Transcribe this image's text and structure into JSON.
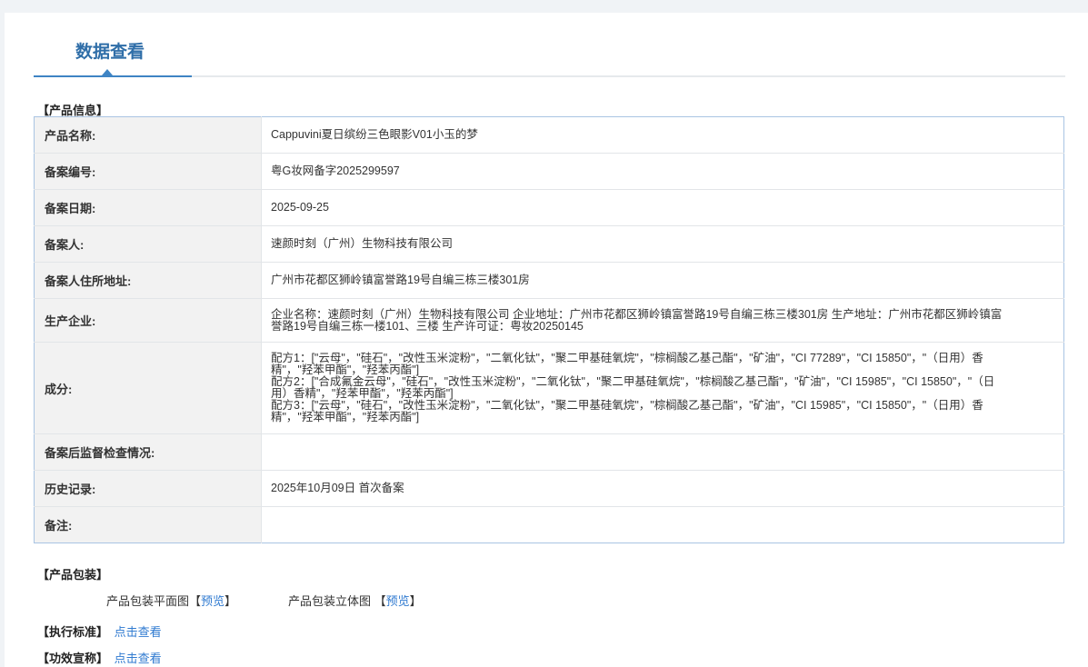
{
  "tab": {
    "title": "数据查看"
  },
  "sections": {
    "product_info": "【产品信息】",
    "packaging": "【产品包装】",
    "standard": "【执行标准】",
    "efficacy": "【功效宣称】"
  },
  "rows": [
    {
      "label": "产品名称:",
      "value": "Cappuvini夏日缤纷三色眼影V01小玉的梦"
    },
    {
      "label": "备案编号:",
      "value": "粤G妆网备字2025299597"
    },
    {
      "label": "备案日期:",
      "value": "2025-09-25"
    },
    {
      "label": "备案人:",
      "value": "速颜时刻（广州）生物科技有限公司"
    },
    {
      "label": "备案人住所地址:",
      "value": "广州市花都区狮岭镇富誉路19号自编三栋三楼301房"
    },
    {
      "label": "生产企业:",
      "value": "企业名称：速颜时刻（广州）生物科技有限公司 企业地址：广州市花都区狮岭镇富誉路19号自编三栋三楼301房 生产地址：广州市花都区狮岭镇富誉路19号自编三栋一楼101、三楼 生产许可证：粤妆20250145"
    },
    {
      "label": "成分:",
      "formulas": [
        "配方1：[\"云母\"，\"硅石\"，\"改性玉米淀粉\"，\"二氧化钛\"，\"聚二甲基硅氧烷\"，\"棕榈酸乙基己酯\"，\"矿油\"，\"CI 77289\"，\"CI 15850\"，\"（日用）香精\"，\"羟苯甲酯\"，\"羟苯丙酯\"]",
        "配方2：[\"合成氟金云母\"，\"硅石\"，\"改性玉米淀粉\"，\"二氧化钛\"，\"聚二甲基硅氧烷\"，\"棕榈酸乙基己酯\"，\"矿油\"，\"CI 15985\"，\"CI 15850\"，\"（日用）香精\"，\"羟苯甲酯\"，\"羟苯丙酯\"]",
        "配方3：[\"云母\"，\"硅石\"，\"改性玉米淀粉\"，\"二氧化钛\"，\"聚二甲基硅氧烷\"，\"棕榈酸乙基己酯\"，\"矿油\"，\"CI 15985\"，\"CI 15850\"，\"（日用）香精\"，\"羟苯甲酯\"，\"羟苯丙酯\"]"
      ]
    },
    {
      "label": "备案后监督检查情况:",
      "value": ""
    },
    {
      "label": "历史记录:",
      "value": "2025年10月09日 首次备案"
    },
    {
      "label": "备注:",
      "value": ""
    }
  ],
  "packaging": {
    "flat_label": "产品包装平面图",
    "flat_link": "预览",
    "stereo_label": "产品包装立体图",
    "stereo_link": "预览"
  },
  "links": {
    "standard_link": "点击查看",
    "efficacy_link": "点击查看"
  }
}
